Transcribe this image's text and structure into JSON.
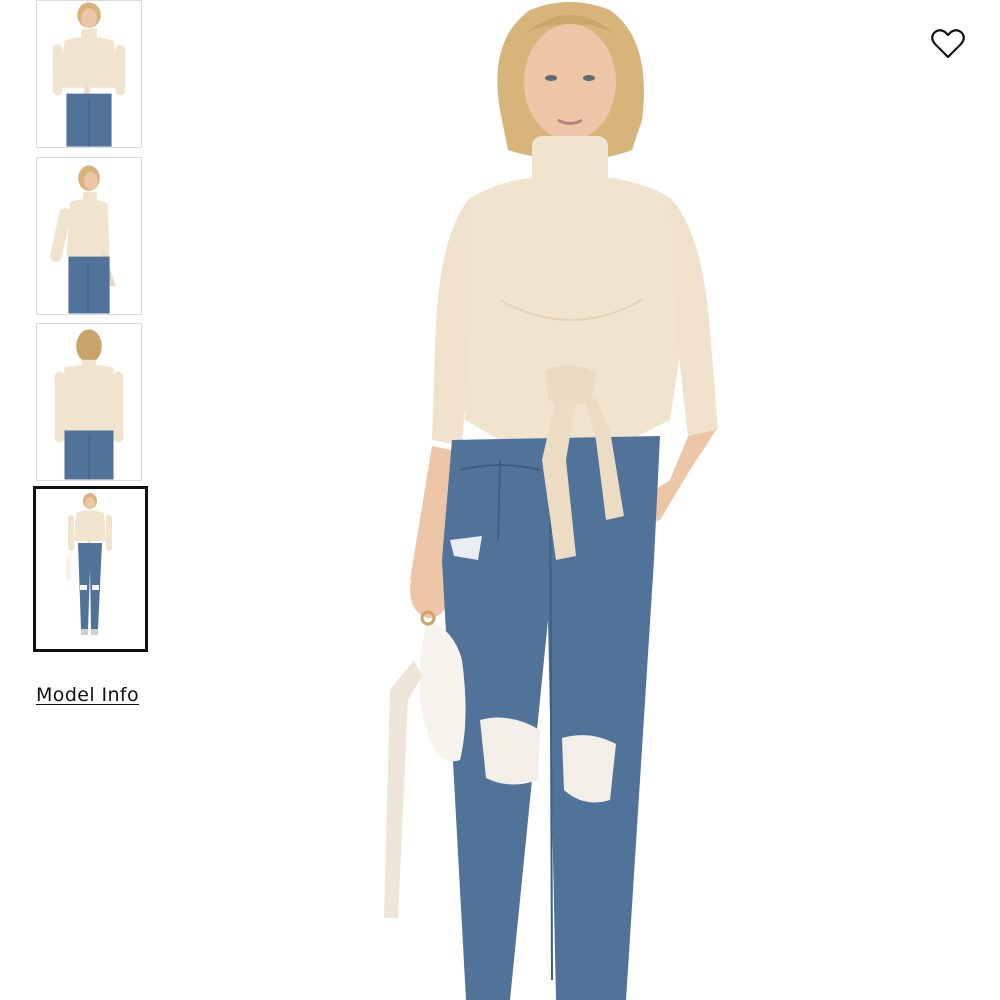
{
  "gallery": {
    "thumbnails": [
      {
        "view": "front-tie-closeup",
        "active": false
      },
      {
        "view": "side",
        "active": false
      },
      {
        "view": "back",
        "active": false
      },
      {
        "view": "full-length",
        "active": true
      }
    ],
    "model_info_label": "Model Info"
  },
  "main_image": {
    "view": "front",
    "alt": ""
  },
  "wishlist": {
    "icon": "heart-outline-icon"
  },
  "colors": {
    "sweater": "#f1e4cf",
    "denim": "#51739a",
    "skin": "#edc6a8",
    "hair": "#d6b47a",
    "bag": "#f7f4ee"
  }
}
